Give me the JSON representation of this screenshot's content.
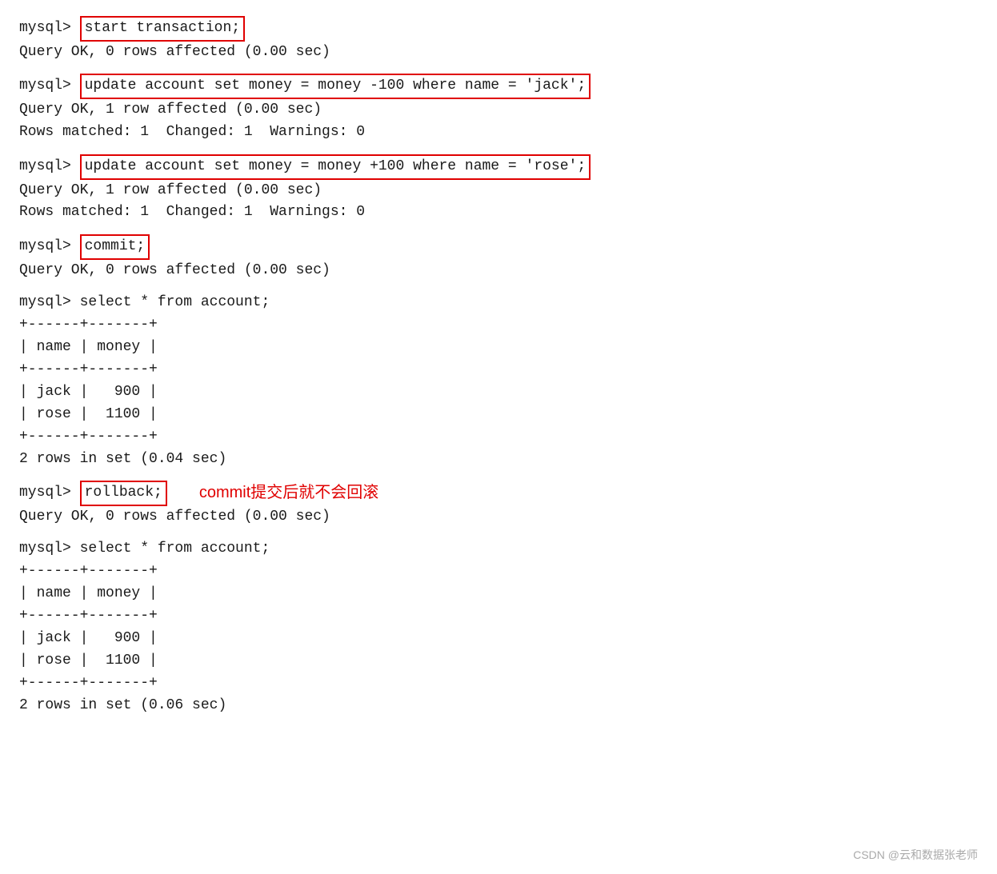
{
  "terminal": {
    "lines": [
      {
        "type": "cmd-line",
        "prompt": "mysql> ",
        "cmd": "start transaction;"
      },
      {
        "type": "output",
        "text": "Query OK, 0 rows affected (0.00 sec)"
      },
      {
        "type": "blank"
      },
      {
        "type": "cmd-line",
        "prompt": "mysql> ",
        "cmd": "update account set money = money -100 where name = 'jack';"
      },
      {
        "type": "output",
        "text": "Query OK, 1 row affected (0.00 sec)"
      },
      {
        "type": "output",
        "text": "Rows matched: 1  Changed: 1  Warnings: 0"
      },
      {
        "type": "blank"
      },
      {
        "type": "cmd-line",
        "prompt": "mysql> ",
        "cmd": "update account set money = money +100 where name = 'rose';"
      },
      {
        "type": "output",
        "text": "Query OK, 1 row affected (0.00 sec)"
      },
      {
        "type": "output",
        "text": "Rows matched: 1  Changed: 1  Warnings: 0"
      },
      {
        "type": "blank"
      },
      {
        "type": "cmd-line",
        "prompt": "mysql> ",
        "cmd": "commit;"
      },
      {
        "type": "output",
        "text": "Query OK, 0 rows affected (0.00 sec)"
      },
      {
        "type": "blank"
      },
      {
        "type": "output",
        "text": "mysql> select * from account;"
      },
      {
        "type": "output",
        "text": "+------+-------+"
      },
      {
        "type": "output",
        "text": "| name | money |"
      },
      {
        "type": "output",
        "text": "+------+-------+"
      },
      {
        "type": "output",
        "text": "| jack |   900 |"
      },
      {
        "type": "output",
        "text": "| rose |  1100 |"
      },
      {
        "type": "output",
        "text": "+------+-------+"
      },
      {
        "type": "output",
        "text": "2 rows in set (0.04 sec)"
      },
      {
        "type": "blank"
      },
      {
        "type": "cmd-line-with-annotation",
        "prompt": "mysql> ",
        "cmd": "rollback;",
        "annotation": "commit提交后就不会回滚"
      },
      {
        "type": "output",
        "text": "Query OK, 0 rows affected (0.00 sec)"
      },
      {
        "type": "blank"
      },
      {
        "type": "output",
        "text": "mysql> select * from account;"
      },
      {
        "type": "output",
        "text": "+------+-------+"
      },
      {
        "type": "output",
        "text": "| name | money |"
      },
      {
        "type": "output",
        "text": "+------+-------+"
      },
      {
        "type": "output",
        "text": "| jack |   900 |"
      },
      {
        "type": "output",
        "text": "| rose |  1100 |"
      },
      {
        "type": "output",
        "text": "+------+-------+"
      },
      {
        "type": "output",
        "text": "2 rows in set (0.06 sec)"
      }
    ]
  },
  "watermark": "CSDN @云和数据张老师"
}
